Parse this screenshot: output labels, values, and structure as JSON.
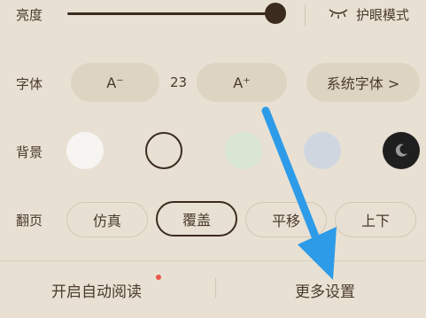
{
  "brightness": {
    "label": "亮度",
    "level": 0.95
  },
  "eye_mode": {
    "label": "护眼模式",
    "icon": "eye-closed-icon"
  },
  "font": {
    "label": "字体",
    "decrease_label": "A⁻",
    "increase_label": "A⁺",
    "size_value": "23",
    "family_label": "系统字体 >"
  },
  "background": {
    "label": "背景",
    "swatches": [
      {
        "color": "#f7f5f2",
        "selected": false
      },
      {
        "color": "#e8e1d3",
        "selected": true
      },
      {
        "color": "#d9e6d2",
        "selected": false
      },
      {
        "color": "#cfd6e0",
        "selected": false
      },
      {
        "color": "#1f1f1f",
        "selected": false,
        "icon": "moon-icon"
      }
    ]
  },
  "page_turn": {
    "label": "翻页",
    "options": [
      "仿真",
      "覆盖",
      "平移",
      "上下"
    ],
    "selected": "覆盖"
  },
  "bottom": {
    "auto_read_label": "开启自动阅读",
    "more_settings_label": "更多设置"
  },
  "colors": {
    "background": "#e8e1d3",
    "accent": "#3b2b1f",
    "pill": "#ddd4c2",
    "arrow": "#2e9be9",
    "dot": "#e8574a"
  }
}
